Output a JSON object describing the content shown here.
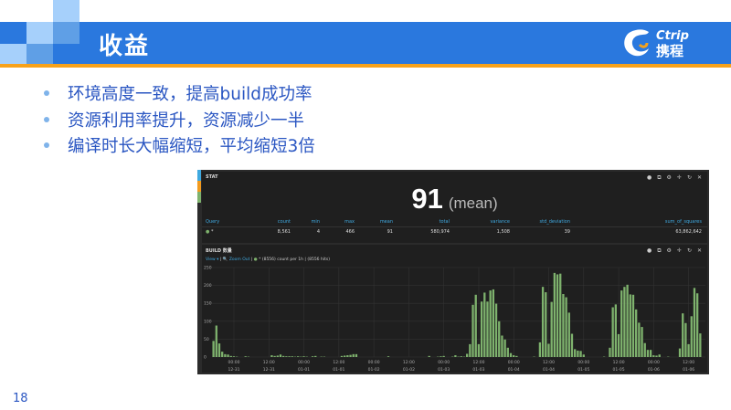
{
  "slide": {
    "title": "收益",
    "page_number": "18",
    "bullets": [
      "环境高度一致，提高build成功率",
      "资源利用率提升，资源减少一半",
      "编译时长大幅缩短，平均缩短3倍"
    ],
    "logo_text": [
      "Ctrip",
      "携程"
    ],
    "colors": {
      "band": "#2a78de",
      "accent": "#f7a21b",
      "text": "#2a56c2"
    }
  },
  "stat_panel": {
    "title": "STAT",
    "value": "91",
    "value_label": "(mean)",
    "icons": [
      "info-icon",
      "copy-icon",
      "gear-icon",
      "move-icon",
      "refresh-icon",
      "close-icon"
    ],
    "columns": [
      "Query",
      "count",
      "min",
      "max",
      "mean",
      "total",
      "variance",
      "std_deviation",
      "sum_of_squares"
    ],
    "row": [
      "*",
      "8,561",
      "4",
      "466",
      "91",
      "580,974",
      "1,508",
      "39",
      "63,862,642"
    ]
  },
  "build_panel": {
    "title": "BUILD 数量",
    "view_label": "View ▾",
    "zoom_out_label": "Zoom Out",
    "legend_text": "* (8556)  count per 1h | (8556 hits)"
  },
  "chart_data": {
    "type": "bar",
    "title": "BUILD 数量",
    "xlabel": "",
    "ylabel": "count per 1h",
    "ylim": [
      0,
      250
    ],
    "yticks": [
      "0",
      "50",
      "100",
      "150",
      "200",
      "250"
    ],
    "x_start": "12-30 17:00",
    "interval": "1h",
    "xticks": [
      [
        "00:00",
        "12-31"
      ],
      [
        "12:00",
        "12-31"
      ],
      [
        "00:00",
        "01-01"
      ],
      [
        "12:00",
        "01-01"
      ],
      [
        "00:00",
        "01-02"
      ],
      [
        "12:00",
        "01-02"
      ],
      [
        "00:00",
        "01-03"
      ],
      [
        "12:00",
        "01-03"
      ],
      [
        "00:00",
        "01-04"
      ],
      [
        "12:00",
        "01-04"
      ],
      [
        "00:00",
        "01-05"
      ],
      [
        "12:00",
        "01-05"
      ],
      [
        "00:00",
        "01-06"
      ],
      [
        "12:00",
        "01-06"
      ]
    ],
    "series": [
      {
        "name": "*",
        "color": "#7eb26d",
        "values": [
          45,
          88,
          38,
          15,
          8,
          7,
          3,
          2,
          1,
          0,
          0,
          2,
          1,
          0,
          0,
          0,
          0,
          0,
          0,
          0,
          5,
          3,
          4,
          7,
          3,
          2,
          2,
          2,
          1,
          2,
          1,
          2,
          1,
          0,
          2,
          3,
          0,
          1,
          1,
          0,
          0,
          0,
          0,
          0,
          3,
          4,
          5,
          6,
          8,
          8,
          0,
          0,
          0,
          0,
          0,
          0,
          0,
          0,
          0,
          0,
          2,
          0,
          0,
          0,
          0,
          0,
          0,
          0,
          0,
          0,
          0,
          0,
          0,
          0,
          3,
          0,
          0,
          1,
          2,
          3,
          0,
          0,
          1,
          5,
          1,
          2,
          1,
          9,
          36,
          146,
          174,
          36,
          155,
          180,
          155,
          186,
          189,
          149,
          100,
          60,
          49,
          26,
          11,
          5,
          3,
          0,
          0,
          0,
          0,
          0,
          1,
          0,
          41,
          196,
          181,
          37,
          154,
          235,
          231,
          233,
          176,
          167,
          124,
          65,
          22,
          18,
          17,
          7,
          0,
          0,
          0,
          0,
          0,
          0,
          1,
          0,
          26,
          139,
          147,
          64,
          186,
          196,
          202,
          175,
          174,
          133,
          96,
          84,
          39,
          20,
          20,
          5,
          4,
          7,
          0,
          0,
          1,
          0,
          0,
          0,
          24,
          122,
          95,
          36,
          114,
          193,
          178,
          66
        ]
      }
    ]
  }
}
